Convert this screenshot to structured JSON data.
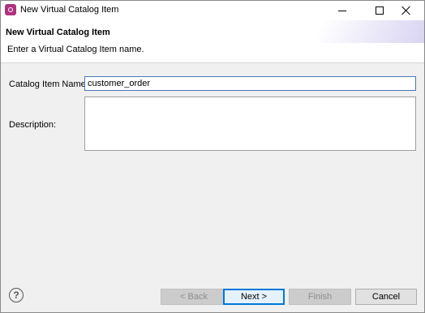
{
  "window": {
    "title": "New Virtual Catalog Item"
  },
  "banner": {
    "title": "New Virtual Catalog Item",
    "message": "Enter a Virtual Catalog Item name."
  },
  "form": {
    "name_label": "Catalog Item Name:",
    "name_value": "customer_order",
    "description_label": "Description:",
    "description_value": ""
  },
  "footer": {
    "help_symbol": "?",
    "back_label": "< Back",
    "next_label": "Next >",
    "finish_label": "Finish",
    "cancel_label": "Cancel"
  },
  "colors": {
    "app_icon": "#b0327d",
    "focus_border": "#0078d7"
  }
}
